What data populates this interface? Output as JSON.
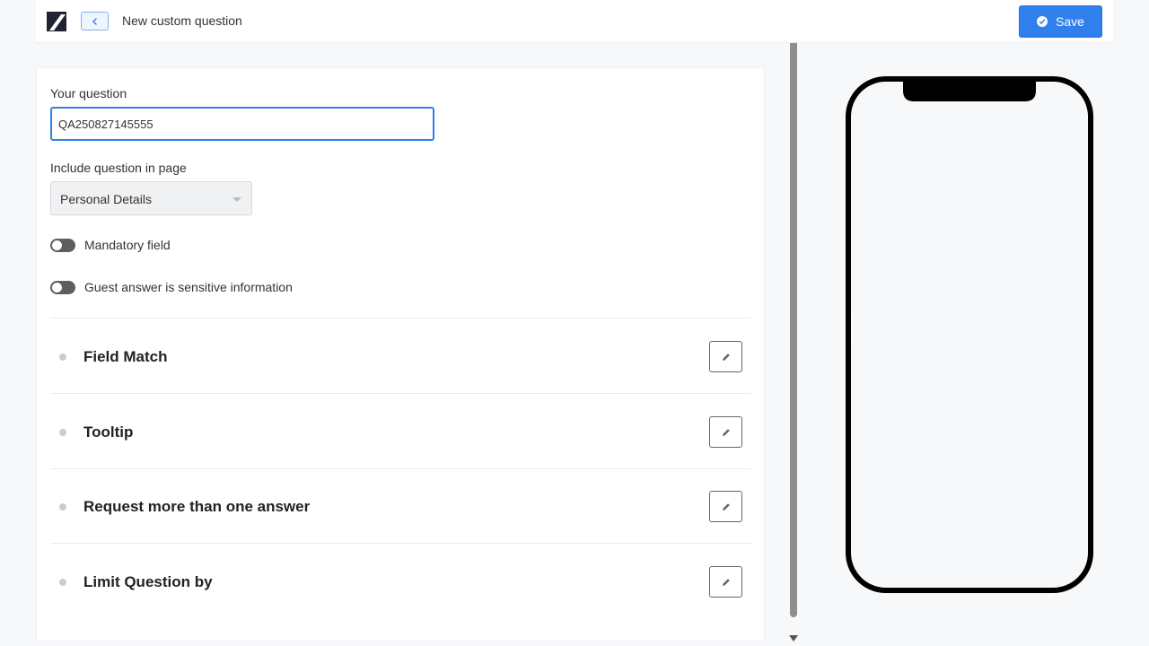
{
  "header": {
    "title": "New custom question",
    "save_label": "Save"
  },
  "form": {
    "question_label": "Your question",
    "question_value": "QA250827145555",
    "page_label": "Include question in page",
    "page_selected": "Personal Details",
    "toggles": [
      {
        "label": "Mandatory field",
        "on": false
      },
      {
        "label": "Guest answer is sensitive information",
        "on": false
      }
    ],
    "sections": [
      {
        "title": "Field Match"
      },
      {
        "title": "Tooltip"
      },
      {
        "title": "Request more than one answer"
      },
      {
        "title": "Limit Question by"
      }
    ]
  },
  "colors": {
    "accent": "#2f80ed",
    "toggle_off": "#5e5e5e"
  },
  "icons": {
    "logo": "app-logo",
    "back": "chevron-left-icon",
    "save": "check-circle-icon",
    "edit": "pencil-icon"
  }
}
